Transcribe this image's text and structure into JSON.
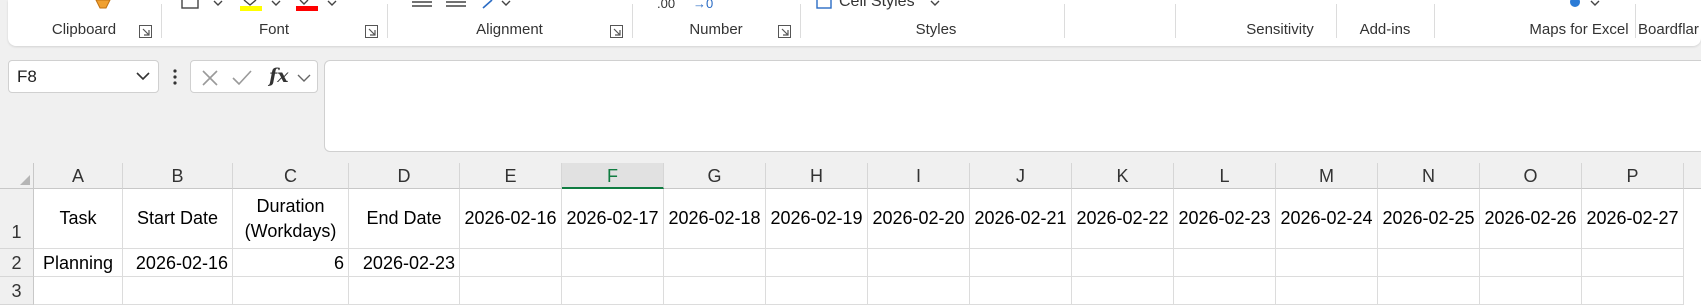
{
  "ribbon": {
    "groups": {
      "clipboard": "Clipboard",
      "font": "Font",
      "alignment": "Alignment",
      "number": "Number",
      "styles": "Styles",
      "sensitivity": "Sensitivity",
      "addins": "Add-ins",
      "maps": "Maps for Excel",
      "boardflare": "Boardflar"
    },
    "number_format_partial": ".00",
    "number_format_partial2": "→0",
    "cell_styles_label": "Cell Styles",
    "colors": {
      "highlight": "#ffff00",
      "font_color": "#ff0000",
      "accent": "#107c41"
    }
  },
  "formula_bar": {
    "name_box": "F8",
    "formula": "",
    "fx_label": "fx",
    "cancel_icon": "x-icon",
    "enter_icon": "check-icon"
  },
  "grid": {
    "columns": [
      "A",
      "B",
      "C",
      "D",
      "E",
      "F",
      "G",
      "H",
      "I",
      "J",
      "K",
      "L",
      "M",
      "N",
      "O",
      "P"
    ],
    "selected_column": "F",
    "rows": [
      "1",
      "2",
      "3"
    ],
    "row1": {
      "A": "Task",
      "B": "Start Date",
      "C": "Duration (Workdays)",
      "D": "End Date",
      "E": "2026-02-16",
      "F": "2026-02-17",
      "G": "2026-02-18",
      "H": "2026-02-19",
      "I": "2026-02-20",
      "J": "2026-02-21",
      "K": "2026-02-22",
      "L": "2026-02-23",
      "M": "2026-02-24",
      "N": "2026-02-25",
      "O": "2026-02-26",
      "P": "2026-02-27"
    },
    "row2": {
      "A": "Planning",
      "B": "2026-02-16",
      "C": "6",
      "D": "2026-02-23"
    }
  }
}
